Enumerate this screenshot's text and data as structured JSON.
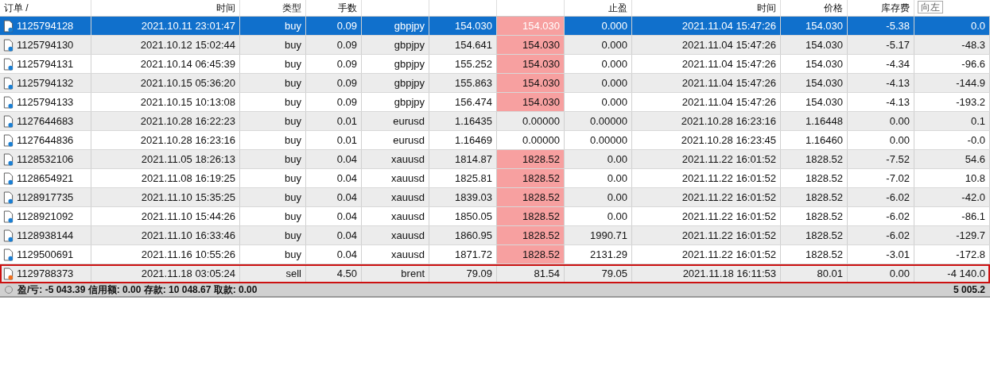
{
  "table": {
    "columns": [
      "订单 /",
      "时间",
      "类型",
      "手数",
      "",
      "",
      "",
      "止盈",
      "时间",
      "价格",
      "库存费"
    ],
    "corner_button": "向左",
    "rows": [
      {
        "kind": "buy",
        "selected": true,
        "marked": false,
        "sl_highlight": true,
        "cells": [
          "1125794128",
          "2021.10.11 23:01:47",
          "buy",
          "0.09",
          "gbpjpy",
          "154.030",
          "154.030",
          "0.000",
          "2021.11.04 15:47:26",
          "154.030",
          "-5.38",
          "0.0"
        ]
      },
      {
        "kind": "buy",
        "selected": false,
        "marked": false,
        "sl_highlight": true,
        "cells": [
          "1125794130",
          "2021.10.12 15:02:44",
          "buy",
          "0.09",
          "gbpjpy",
          "154.641",
          "154.030",
          "0.000",
          "2021.11.04 15:47:26",
          "154.030",
          "-5.17",
          "-48.3"
        ]
      },
      {
        "kind": "buy",
        "selected": false,
        "marked": false,
        "sl_highlight": true,
        "cells": [
          "1125794131",
          "2021.10.14 06:45:39",
          "buy",
          "0.09",
          "gbpjpy",
          "155.252",
          "154.030",
          "0.000",
          "2021.11.04 15:47:26",
          "154.030",
          "-4.34",
          "-96.6"
        ]
      },
      {
        "kind": "buy",
        "selected": false,
        "marked": false,
        "sl_highlight": true,
        "cells": [
          "1125794132",
          "2021.10.15 05:36:20",
          "buy",
          "0.09",
          "gbpjpy",
          "155.863",
          "154.030",
          "0.000",
          "2021.11.04 15:47:26",
          "154.030",
          "-4.13",
          "-144.9"
        ]
      },
      {
        "kind": "buy",
        "selected": false,
        "marked": false,
        "sl_highlight": true,
        "cells": [
          "1125794133",
          "2021.10.15 10:13:08",
          "buy",
          "0.09",
          "gbpjpy",
          "156.474",
          "154.030",
          "0.000",
          "2021.11.04 15:47:26",
          "154.030",
          "-4.13",
          "-193.2"
        ]
      },
      {
        "kind": "buy",
        "selected": false,
        "marked": false,
        "sl_highlight": false,
        "cells": [
          "1127644683",
          "2021.10.28 16:22:23",
          "buy",
          "0.01",
          "eurusd",
          "1.16435",
          "0.00000",
          "0.00000",
          "2021.10.28 16:23:16",
          "1.16448",
          "0.00",
          "0.1"
        ]
      },
      {
        "kind": "buy",
        "selected": false,
        "marked": false,
        "sl_highlight": false,
        "cells": [
          "1127644836",
          "2021.10.28 16:23:16",
          "buy",
          "0.01",
          "eurusd",
          "1.16469",
          "0.00000",
          "0.00000",
          "2021.10.28 16:23:45",
          "1.16460",
          "0.00",
          "-0.0"
        ]
      },
      {
        "kind": "buy",
        "selected": false,
        "marked": false,
        "sl_highlight": true,
        "cells": [
          "1128532106",
          "2021.11.05 18:26:13",
          "buy",
          "0.04",
          "xauusd",
          "1814.87",
          "1828.52",
          "0.00",
          "2021.11.22 16:01:52",
          "1828.52",
          "-7.52",
          "54.6"
        ]
      },
      {
        "kind": "buy",
        "selected": false,
        "marked": false,
        "sl_highlight": true,
        "cells": [
          "1128654921",
          "2021.11.08 16:19:25",
          "buy",
          "0.04",
          "xauusd",
          "1825.81",
          "1828.52",
          "0.00",
          "2021.11.22 16:01:52",
          "1828.52",
          "-7.02",
          "10.8"
        ]
      },
      {
        "kind": "buy",
        "selected": false,
        "marked": false,
        "sl_highlight": true,
        "cells": [
          "1128917735",
          "2021.11.10 15:35:25",
          "buy",
          "0.04",
          "xauusd",
          "1839.03",
          "1828.52",
          "0.00",
          "2021.11.22 16:01:52",
          "1828.52",
          "-6.02",
          "-42.0"
        ]
      },
      {
        "kind": "buy",
        "selected": false,
        "marked": false,
        "sl_highlight": true,
        "cells": [
          "1128921092",
          "2021.11.10 15:44:26",
          "buy",
          "0.04",
          "xauusd",
          "1850.05",
          "1828.52",
          "0.00",
          "2021.11.22 16:01:52",
          "1828.52",
          "-6.02",
          "-86.1"
        ]
      },
      {
        "kind": "buy",
        "selected": false,
        "marked": false,
        "sl_highlight": true,
        "cells": [
          "1128938144",
          "2021.11.10 16:33:46",
          "buy",
          "0.04",
          "xauusd",
          "1860.95",
          "1828.52",
          "1990.71",
          "2021.11.22 16:01:52",
          "1828.52",
          "-6.02",
          "-129.7"
        ]
      },
      {
        "kind": "buy",
        "selected": false,
        "marked": false,
        "sl_highlight": true,
        "cells": [
          "1129500691",
          "2021.11.16 10:55:26",
          "buy",
          "0.04",
          "xauusd",
          "1871.72",
          "1828.52",
          "2131.29",
          "2021.11.22 16:01:52",
          "1828.52",
          "-3.01",
          "-172.8"
        ]
      },
      {
        "kind": "sell",
        "selected": false,
        "marked": true,
        "sl_highlight": false,
        "cells": [
          "1129788373",
          "2021.11.18 03:05:24",
          "sell",
          "4.50",
          "brent",
          "79.09",
          "81.54",
          "79.05",
          "2021.11.18 16:11:53",
          "80.01",
          "0.00",
          "-4 140.0"
        ]
      }
    ]
  },
  "status_bar": {
    "summary": "盈/亏: -5 043.39  信用额: 0.00  存款: 10 048.67  取款: 0.00",
    "total": "5 005.2"
  }
}
